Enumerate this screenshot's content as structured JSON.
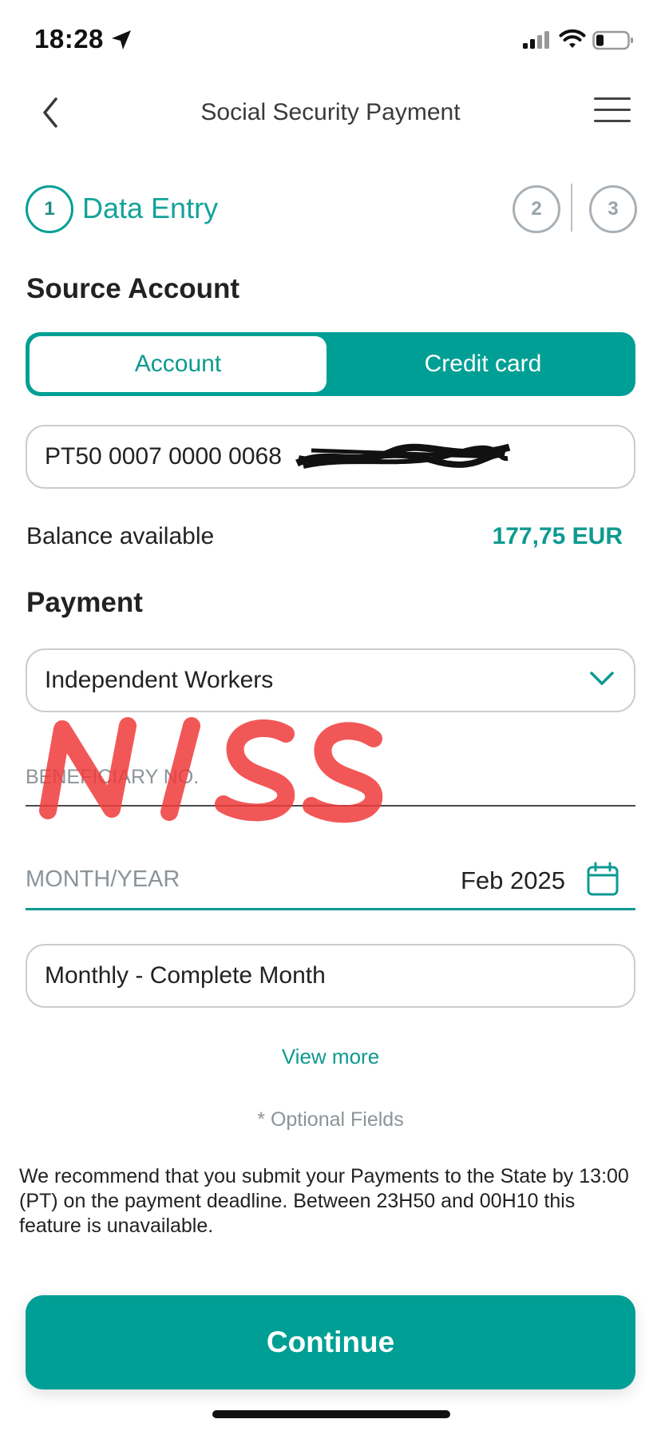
{
  "status_bar": {
    "time": "18:28",
    "icons": [
      "location-arrow-icon",
      "cellular-signal-icon",
      "wifi-icon",
      "battery-icon"
    ]
  },
  "header": {
    "title": "Social Security Payment",
    "back_icon": "chevron-left-icon",
    "menu_icon": "hamburger-menu-icon"
  },
  "stepper": {
    "steps": [
      {
        "number": "1",
        "label": "Data Entry",
        "active": true
      },
      {
        "number": "2",
        "active": false
      },
      {
        "number": "3",
        "active": false
      }
    ]
  },
  "source_account": {
    "title": "Source Account",
    "tabs": [
      {
        "label": "Account",
        "selected": true
      },
      {
        "label": "Credit card",
        "selected": false
      }
    ],
    "account_number": "PT50 0007 0000 0068",
    "balance_label": "Balance available",
    "balance_value": "177,75 EUR"
  },
  "payment": {
    "title": "Payment",
    "type_value": "Independent Workers",
    "beneficiary_label": "BENEFICIARY NO.",
    "handwritten_overlay": "NISS",
    "month_year_label": "MONTH/YEAR",
    "month_year_value": "Feb 2025",
    "period_value": "Monthly - Complete Month"
  },
  "view_more": "View more",
  "optional_note": "* Optional Fields",
  "recommendation": "We recommend that you submit your Payments to the State by 13:00 (PT) on the payment deadline. Between 23H50 and 00H10 this feature is unavailable.",
  "continue_label": "Continue",
  "colors": {
    "accent": "#009f95",
    "accent_text": "#0e9a90",
    "muted": "#8c9499",
    "overlay_red": "#f03a3a"
  }
}
